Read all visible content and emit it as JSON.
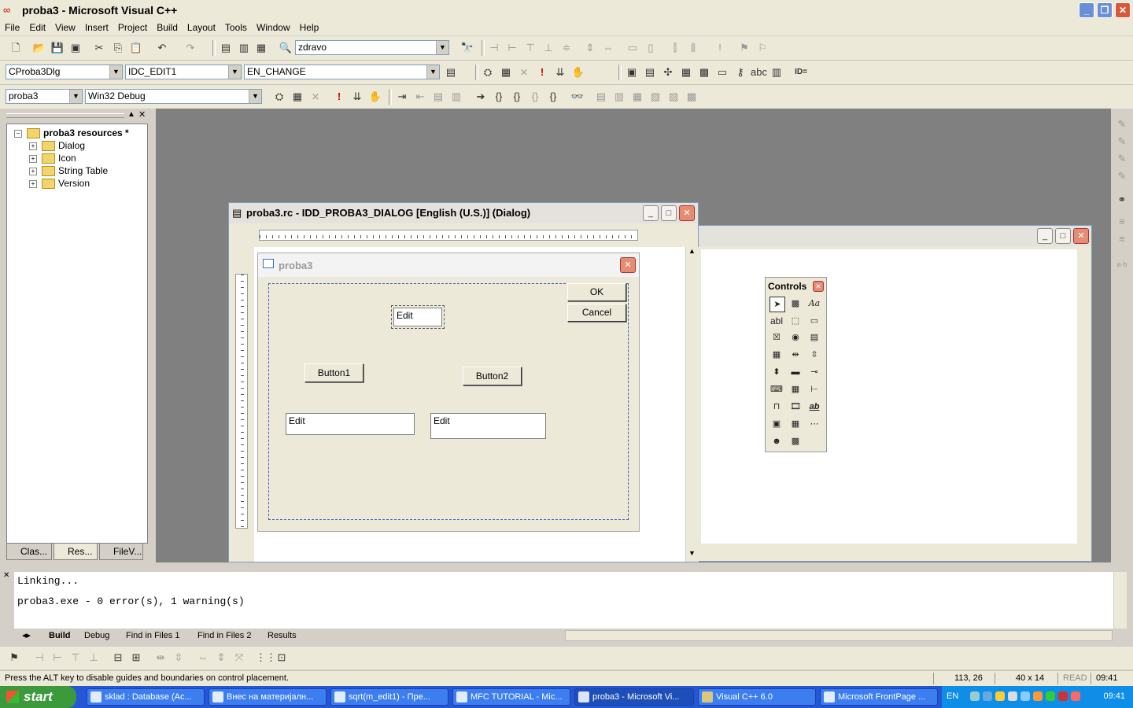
{
  "app": {
    "title": "proba3 - Microsoft Visual C++"
  },
  "menu": [
    "File",
    "Edit",
    "View",
    "Insert",
    "Project",
    "Build",
    "Layout",
    "Tools",
    "Window",
    "Help"
  ],
  "toolbar": {
    "find_combo": "zdravo",
    "class_combo": "CProba3Dlg",
    "id_combo": "IDC_EDIT1",
    "message_combo": "EN_CHANGE",
    "project_combo": "proba3",
    "config_combo": "Win32 Debug",
    "id_label": "ID="
  },
  "workspace": {
    "root": "proba3 resources *",
    "items": [
      "Dialog",
      "Icon",
      "String Table",
      "Version"
    ],
    "tabs": [
      "Clas...",
      "Res...",
      "FileV..."
    ]
  },
  "editor": {
    "title": "proba3.rc - IDD_PROBA3_DIALOG [English (U.S.)] (Dialog)",
    "dialog_title": "proba3",
    "ok": "OK",
    "cancel": "Cancel",
    "edit_selected": "Edit",
    "button1": "Button1",
    "button2": "Button2",
    "edit2": "Edit",
    "edit3": "Edit"
  },
  "controls": {
    "title": "Controls",
    "abl": "abl",
    "aa": "Aa",
    "ab": "ab"
  },
  "output": {
    "lines": [
      "Linking...",
      "proba3.exe - 0 error(s), 1 warning(s)"
    ],
    "tabs": [
      "Build",
      "Debug",
      "Find in Files 1",
      "Find in Files 2",
      "Results"
    ]
  },
  "status": {
    "message": "Press the ALT key to disable guides and boundaries on control placement.",
    "position": "113, 26",
    "size": "40 x 14",
    "read": "READ",
    "time": "09:41"
  },
  "taskbar": {
    "start": "start",
    "tasks": [
      "sklad : Database (Ac...",
      "Внес на материјалн...",
      "sqrt(m_edit1) - Пре...",
      "MFC TUTORIAL - Mic...",
      "proba3 - Microsoft Vi...",
      "Visual C++ 6.0",
      "Microsoft FrontPage ..."
    ],
    "lang": "EN",
    "clock": "09:41"
  }
}
